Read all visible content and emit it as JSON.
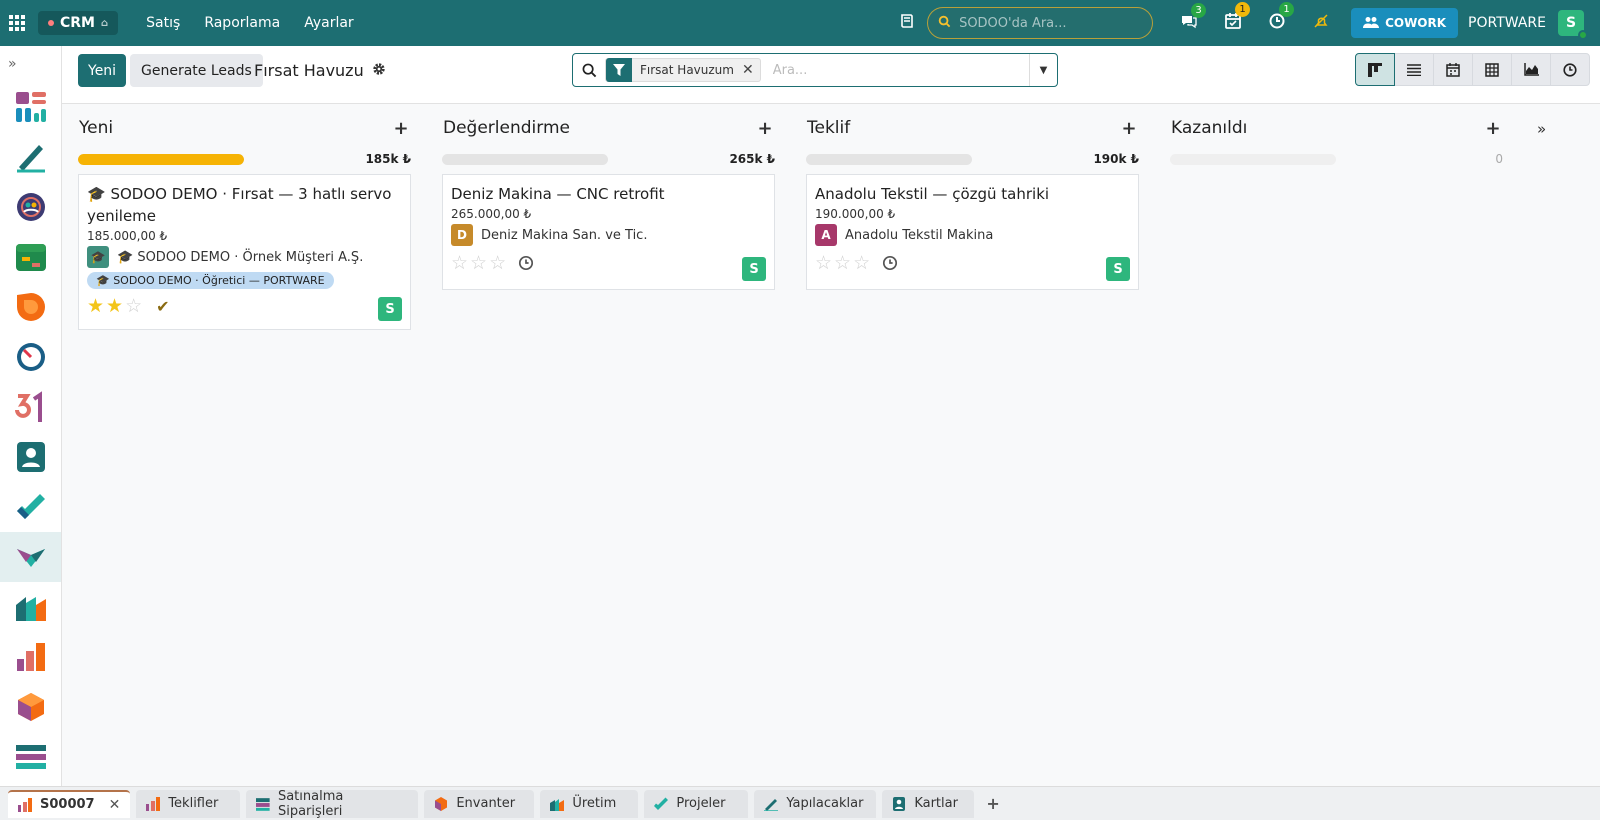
{
  "navbar": {
    "app_name": "CRM",
    "menu": [
      "Satış",
      "Raporlama",
      "Ayarlar"
    ],
    "search_placeholder": "SODOO'da Ara...",
    "messages_count": "3",
    "activities_count": "1",
    "timers_count": "1",
    "cowork_label": "COWORK",
    "company": "PORTWARE",
    "user_initial": "S"
  },
  "control_panel": {
    "new_label": "Yeni",
    "generate_label": "Generate Leads",
    "title": "Fırsat Havuzu",
    "facet_label": "Fırsat Havuzum",
    "search_placeholder": "Ara..."
  },
  "columns": [
    {
      "title": "Yeni",
      "sum": "185k ₺",
      "progress": 1.0,
      "cards": [
        {
          "title": "🎓 SODOO DEMO · Fırsat — 3 hatlı servo yenileme",
          "amount": "185.000,00 ₺",
          "partner": "🎓 SODOO DEMO · Örnek Müşteri A.Ş.",
          "partner_avatar": "🎓",
          "partner_color": "#3f8f7e",
          "tag": "🎓 SODOO DEMO · Öğretici — PORTWARE",
          "stars": 2,
          "activity": "done",
          "salesperson": "S"
        }
      ]
    },
    {
      "title": "Değerlendirme",
      "sum": "265k ₺",
      "progress": 0,
      "cards": [
        {
          "title": "Deniz Makina — CNC retrofit",
          "amount": "265.000,00 ₺",
          "partner": "Deniz Makina San. ve Tic.",
          "partner_avatar": "D",
          "partner_color": "#c68a2a",
          "stars": 0,
          "activity": "clock",
          "salesperson": "S"
        }
      ]
    },
    {
      "title": "Teklif",
      "sum": "190k ₺",
      "progress": 0,
      "cards": [
        {
          "title": "Anadolu Tekstil — çözgü tahriki",
          "amount": "190.000,00 ₺",
          "partner": "Anadolu Tekstil Makina",
          "partner_avatar": "A",
          "partner_color": "#a7386a",
          "stars": 0,
          "activity": "clock",
          "salesperson": "S"
        }
      ]
    },
    {
      "title": "Kazanıldı",
      "sum": "0",
      "progress": 0,
      "cards": []
    }
  ],
  "bottom_tabs": [
    {
      "label": "S00007",
      "active": true,
      "icon": "sales-icon"
    },
    {
      "label": "Teklifler",
      "icon": "sales-icon"
    },
    {
      "label": "Satınalma Siparişleri",
      "icon": "purchase-icon"
    },
    {
      "label": "Envanter",
      "icon": "inventory-icon"
    },
    {
      "label": "Üretim",
      "icon": "manufacturing-icon"
    },
    {
      "label": "Projeler",
      "icon": "project-icon"
    },
    {
      "label": "Yapılacaklar",
      "icon": "todo-icon"
    },
    {
      "label": "Kartlar",
      "icon": "contacts-icon"
    }
  ]
}
